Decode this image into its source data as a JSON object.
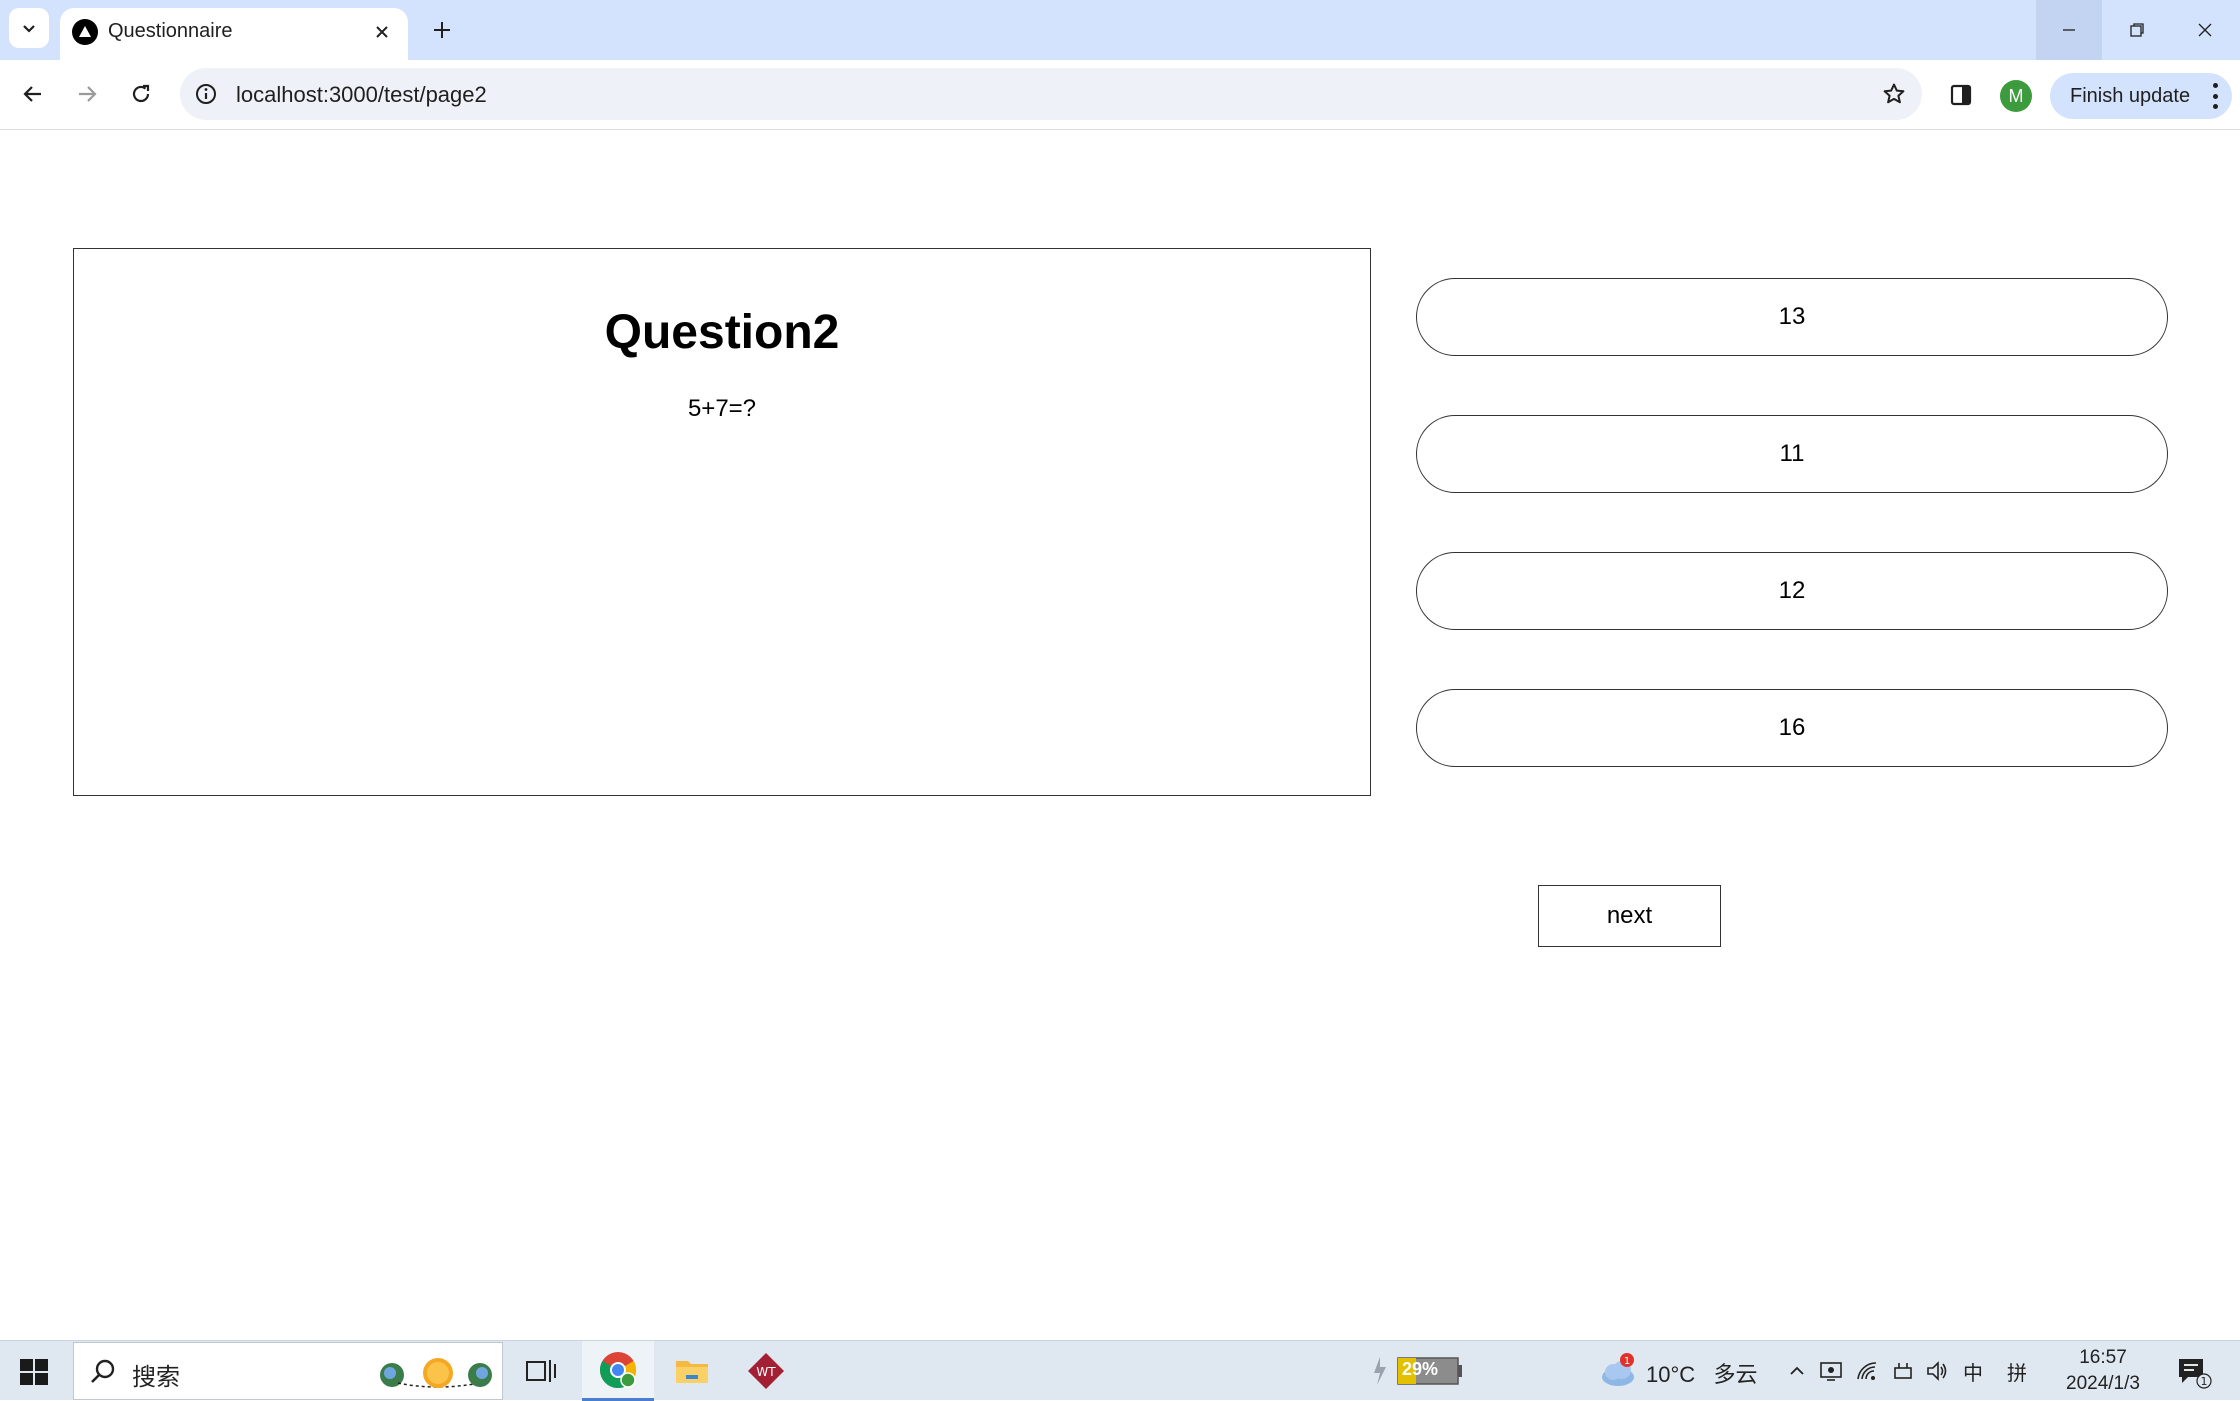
{
  "browser": {
    "tab_title": "Questionnaire",
    "url": "localhost:3000/test/page2",
    "profile_initial": "M",
    "finish_update_label": "Finish update"
  },
  "question": {
    "title": "Question2",
    "text": "5+7=?"
  },
  "options": [
    {
      "label": "13"
    },
    {
      "label": "11"
    },
    {
      "label": "12"
    },
    {
      "label": "16"
    }
  ],
  "next_label": "next",
  "taskbar": {
    "search_placeholder": "搜索",
    "battery": "29%",
    "weather_temp": "10°C",
    "weather_desc": "多云",
    "weather_badge": "1",
    "ime_lang": "中",
    "ime_mode": "拼",
    "time": "16:57",
    "date": "2024/1/3",
    "notification_count": "1"
  },
  "colors": {
    "tabstrip": "#d3e3fd",
    "omnibox": "#eef1f7",
    "avatar": "#3c9b3c",
    "taskbar": "#dfe8f0"
  }
}
